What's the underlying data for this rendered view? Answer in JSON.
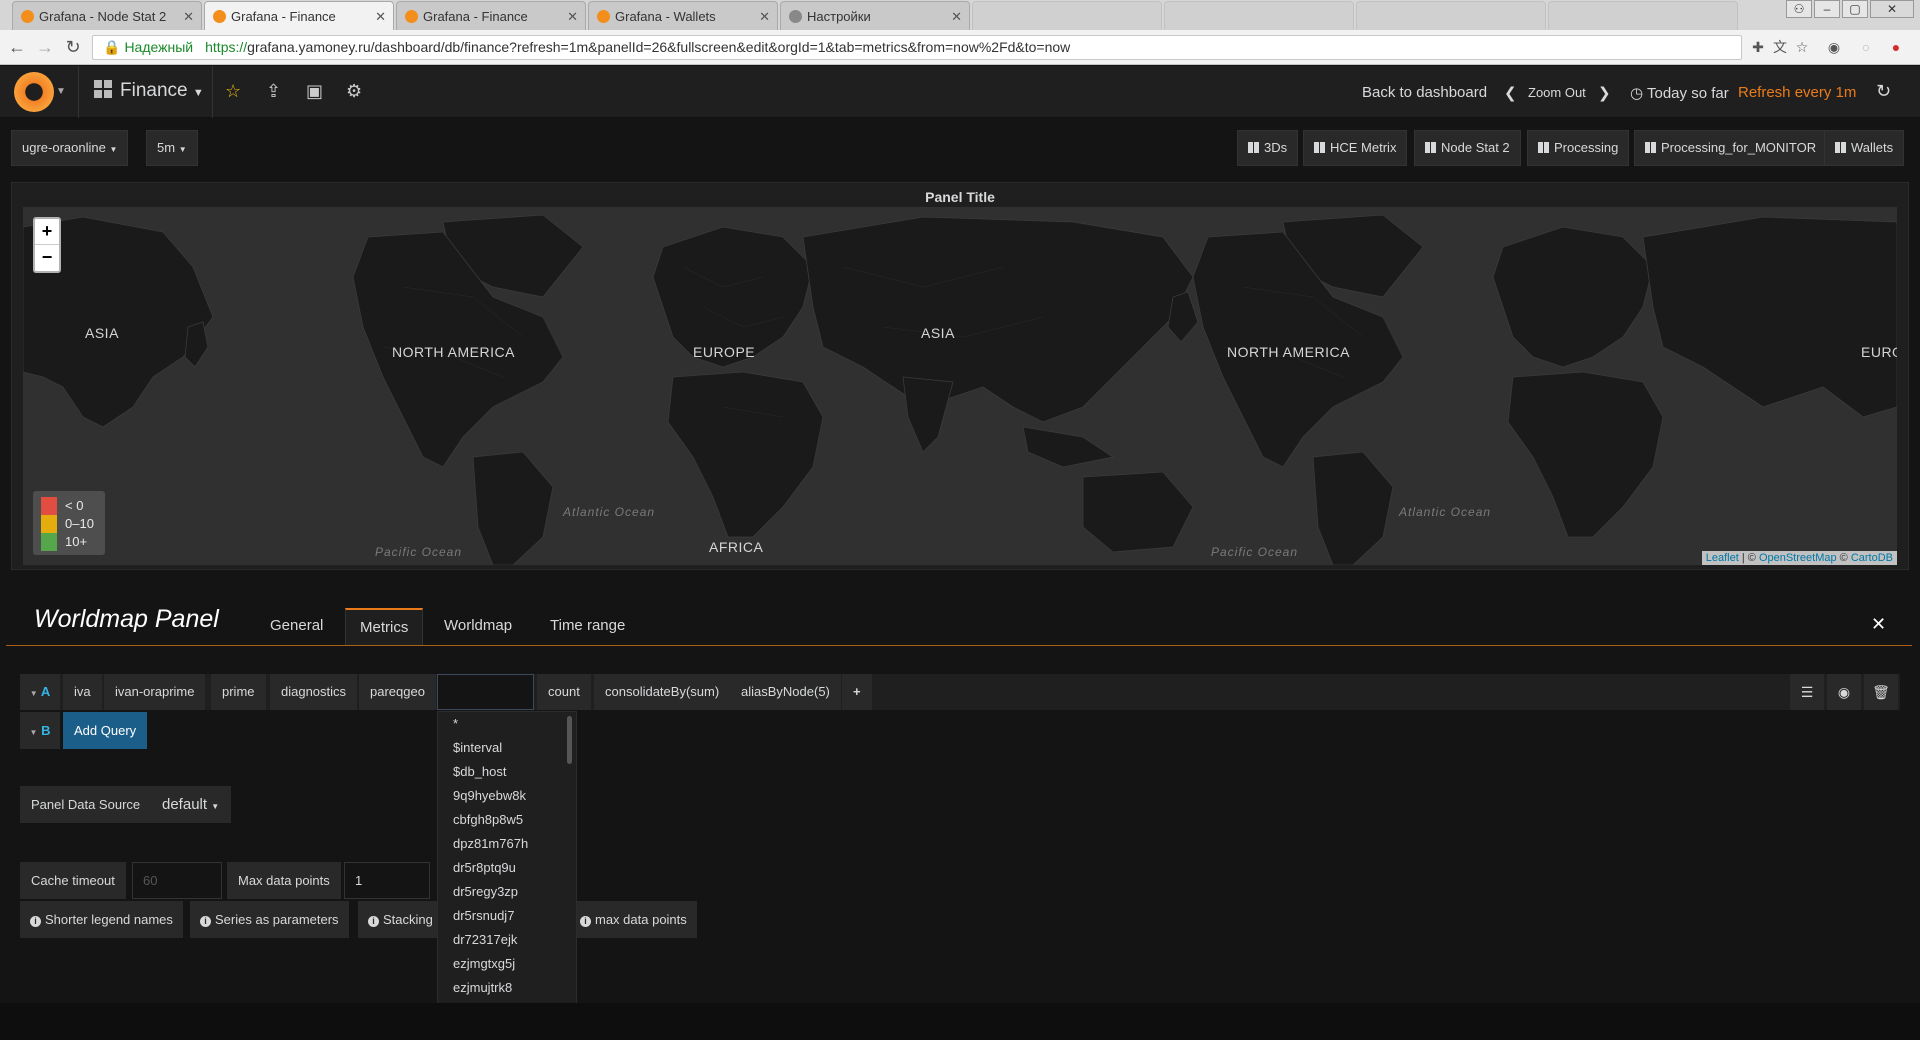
{
  "browser": {
    "tabs": [
      {
        "title": "Grafana - Node Stat 2",
        "active": false
      },
      {
        "title": "Grafana - Finance",
        "active": true
      },
      {
        "title": "Grafana - Finance",
        "active": false
      },
      {
        "title": "Grafana - Wallets",
        "active": false
      },
      {
        "title": "Настройки",
        "active": false
      }
    ],
    "secure_label": "Надежный",
    "url_proto": "https://",
    "url_rest": "grafana.yamoney.ru/dashboard/db/finance?refresh=1m&panelId=26&fullscreen&edit&orgId=1&tab=metrics&from=now%2Fd&to=now"
  },
  "navbar": {
    "dashboard_title": "Finance",
    "back_label": "Back to dashboard",
    "zoom_out_label": "Zoom Out",
    "time_label": "Today so far",
    "refresh_label": "Refresh every 1m"
  },
  "variables": [
    {
      "value": "ugre-oraonline"
    },
    {
      "value": "5m"
    }
  ],
  "dash_links": [
    "3Ds",
    "HCE Metrix",
    "Node Stat 2",
    "Processing",
    "Processing_for_MONITOR",
    "Wallets"
  ],
  "panel": {
    "title": "Panel Title",
    "zoom_in": "+",
    "zoom_out": "−",
    "map_labels": [
      "ASIA",
      "NORTH AMERICA",
      "EUROPE",
      "ASIA",
      "NORTH AMERICA",
      "EURO",
      "AFRICA"
    ],
    "ocean_labels": [
      "Atlantic Ocean",
      "Atlantic Ocean",
      "Pacific Ocean",
      "Pacific Ocean"
    ],
    "legend": [
      {
        "label": "< 0",
        "color": "#e24d42"
      },
      {
        "label": "0–10",
        "color": "#e5ac0e"
      },
      {
        "label": "10+",
        "color": "#56a64b"
      }
    ],
    "attribution": {
      "leaflet": "Leaflet",
      "sep1": " | © ",
      "osm": "OpenStreetMap",
      "sep2": " © ",
      "carto": "CartoDB"
    }
  },
  "editor": {
    "title": "Worldmap Panel",
    "tabs": [
      "General",
      "Metrics",
      "Worldmap",
      "Time range"
    ],
    "active_tab": "Metrics",
    "query_a": {
      "letter": "A",
      "segments": [
        "iva",
        "ivan-oraprime",
        "prime",
        "diagnostics",
        "pareqgeo"
      ],
      "functions": [
        "count",
        "consolidateBy(sum)",
        "aliasByNode(5)"
      ],
      "add": "+"
    },
    "query_b": {
      "letter": "B"
    },
    "add_query_label": "Add Query",
    "data_source_label": "Panel Data Source",
    "data_source_value": "default",
    "cache_timeout_label": "Cache timeout",
    "cache_timeout_placeholder": "60",
    "max_points_label": "Max data points",
    "max_points_value": "1",
    "info_buttons": [
      "Shorter legend names",
      "Series as parameters",
      "Stacking",
      "max data points"
    ],
    "dropdown_items": [
      "*",
      "$interval",
      "$db_host",
      "9q9hyebw8k",
      "cbfgh8p8w5",
      "dpz81m767h",
      "dr5r8ptq9u",
      "dr5regy3zp",
      "dr5rsnudj7",
      "dr72317ejk",
      "ezjmgtxg5j",
      "ezjmujtrk8"
    ]
  }
}
